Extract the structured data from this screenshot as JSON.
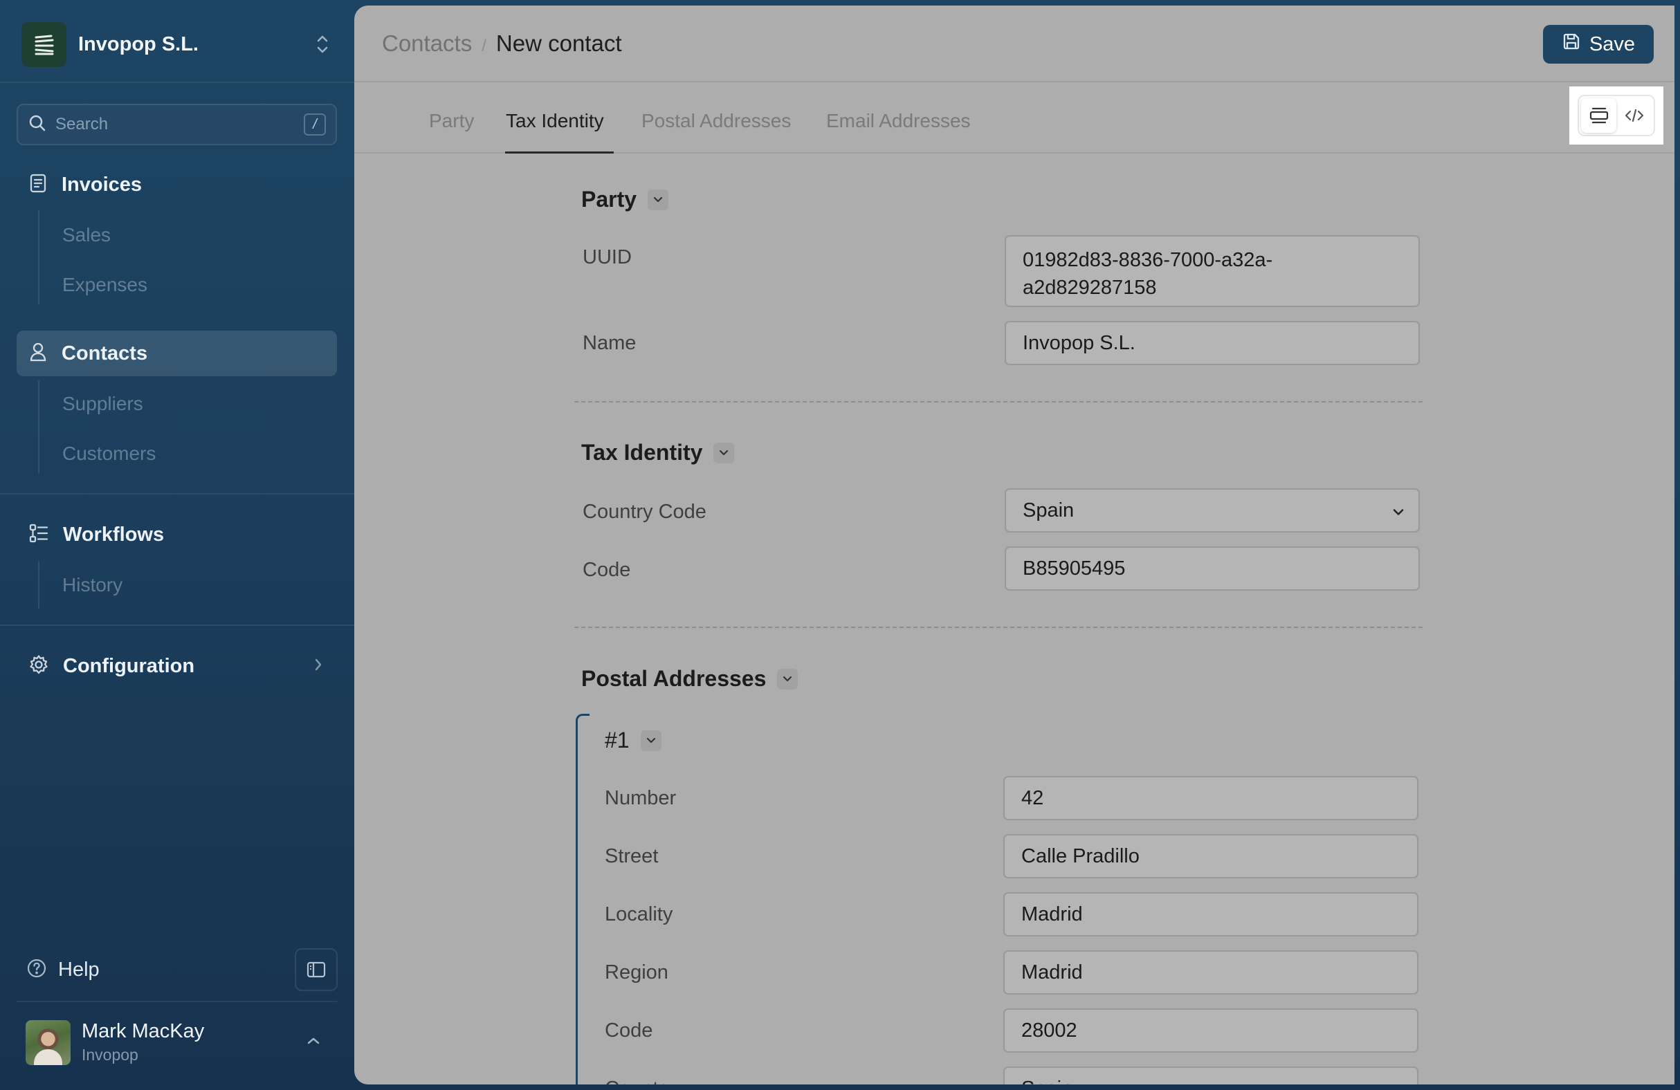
{
  "sidebar": {
    "org_name": "Invopop S.L.",
    "search_placeholder": "Search",
    "search_shortcut": "/",
    "sections": [
      {
        "label": "Invoices",
        "icon": "invoice-icon",
        "children": [
          "Sales",
          "Expenses"
        ]
      },
      {
        "label": "Contacts",
        "icon": "user-icon",
        "active": true,
        "children": [
          "Suppliers",
          "Customers"
        ]
      },
      {
        "label": "Workflows",
        "icon": "workflow-icon",
        "children": [
          "History"
        ]
      },
      {
        "label": "Configuration",
        "icon": "gear-icon"
      }
    ],
    "help_label": "Help",
    "user": {
      "name": "Mark MacKay",
      "org": "Invopop"
    }
  },
  "header": {
    "breadcrumb_parent": "Contacts",
    "breadcrumb_current": "New contact",
    "save_label": "Save"
  },
  "tabs": [
    "Party",
    "Tax Identity",
    "Postal Addresses",
    "Email Addresses"
  ],
  "active_tab": "Tax Identity",
  "form": {
    "party": {
      "title": "Party",
      "uuid_label": "UUID",
      "uuid_line1": "01982d83-8836-7000-a32a-",
      "uuid_line2": "a2d829287158",
      "name_label": "Name",
      "name_value": "Invopop S.L."
    },
    "tax_identity": {
      "title": "Tax Identity",
      "country_label": "Country Code",
      "country_value": "Spain",
      "code_label": "Code",
      "code_value": "B85905495"
    },
    "postal_addresses": {
      "title": "Postal Addresses",
      "item_title": "#1",
      "number_label": "Number",
      "number_value": "42",
      "street_label": "Street",
      "street_value": "Calle Pradillo",
      "locality_label": "Locality",
      "locality_value": "Madrid",
      "region_label": "Region",
      "region_value": "Madrid",
      "code_label": "Code",
      "code_value": "28002",
      "country_label": "Country",
      "country_value": "Spain"
    }
  },
  "colors": {
    "brand": "#1d4563",
    "overlay_panel": "#adadad"
  }
}
